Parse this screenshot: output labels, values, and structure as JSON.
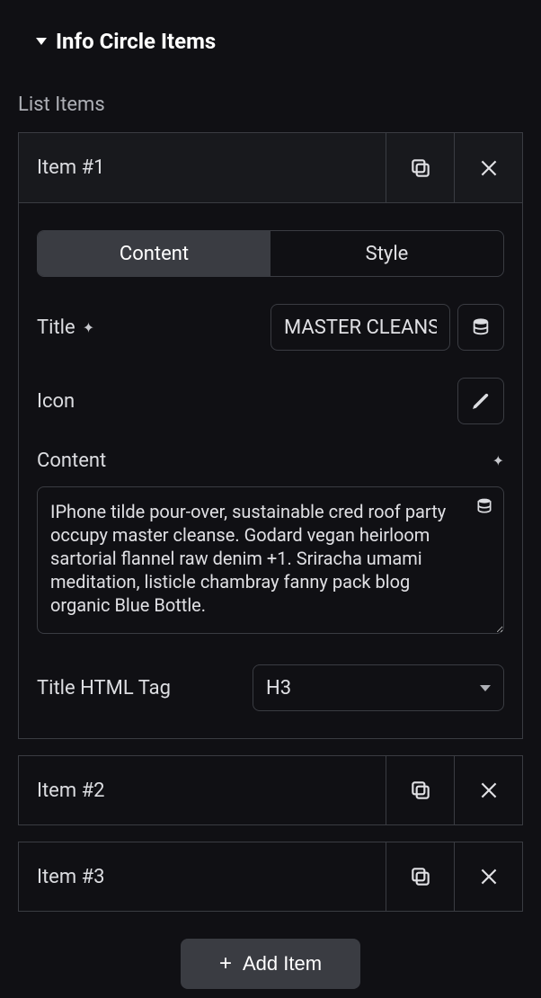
{
  "section": {
    "title": "Info Circle Items"
  },
  "list": {
    "label": "List Items",
    "addButton": "Add Item",
    "items": [
      {
        "label": "Item #1"
      },
      {
        "label": "Item #2"
      },
      {
        "label": "Item #3"
      }
    ]
  },
  "tabs": {
    "content": "Content",
    "style": "Style"
  },
  "fields": {
    "titleLabel": "Title",
    "titleValue": "MASTER CLEANSE",
    "iconLabel": "Icon",
    "contentLabel": "Content",
    "contentValue": "IPhone tilde pour-over, sustainable cred roof party occupy master cleanse. Godard vegan heirloom sartorial flannel raw denim +1. Sriracha umami meditation, listicle chambray fanny pack blog organic Blue Bottle.",
    "htmlTagLabel": "Title HTML Tag",
    "htmlTagValue": "H3"
  }
}
